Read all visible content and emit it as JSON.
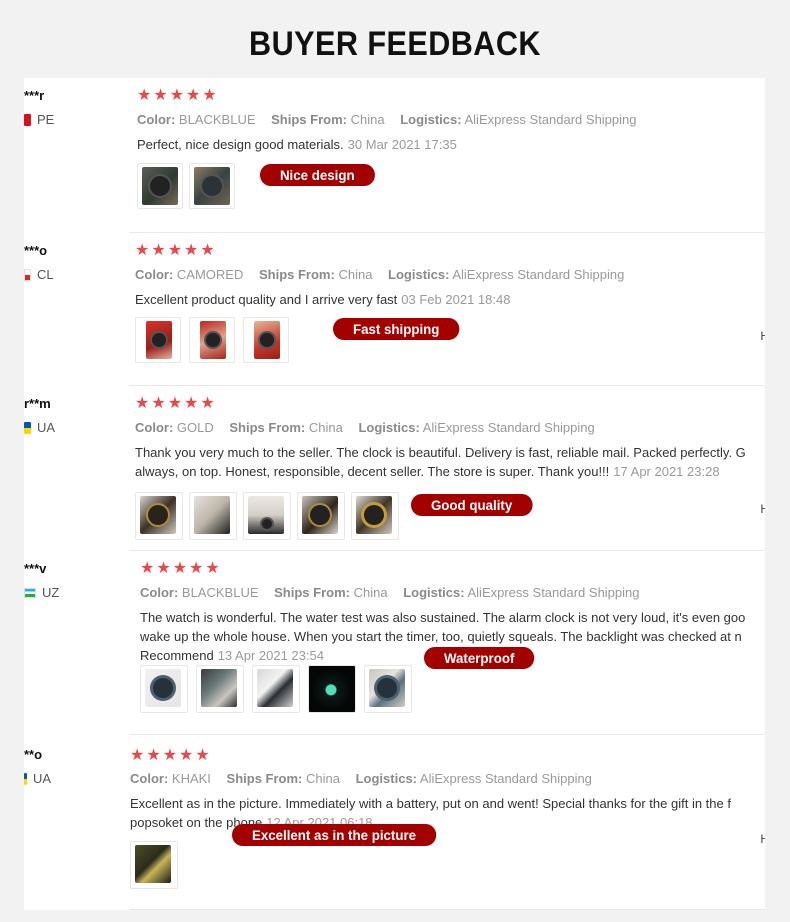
{
  "page": {
    "title": "BUYER FEEDBACK"
  },
  "colors": {
    "star": "#e8484a",
    "tag": "#a30000",
    "text": "#333333",
    "muted": "#999999"
  },
  "labels": {
    "color": "Color:",
    "ships_from": "Ships From:",
    "logistics": "Logistics:"
  },
  "reviews": [
    {
      "user": "***r",
      "country": "PE",
      "stars": [
        "★",
        "★",
        "★",
        "★",
        "★"
      ],
      "color": "BLACKBLUE",
      "ships_from": "China",
      "logistics": "AliExpress Standard Shipping",
      "comment_lines": [
        "Perfect, nice design good materials."
      ],
      "date": "30 Mar 2021 17:35",
      "tag": "Nice design",
      "edge": "",
      "photos": [
        "watch-photo",
        "watch-photo"
      ]
    },
    {
      "user": "***o",
      "country": "CL",
      "stars": [
        "★",
        "★",
        "★",
        "★",
        "★"
      ],
      "color": "CAMORED",
      "ships_from": "China",
      "logistics": "AliExpress Standard Shipping",
      "comment_lines": [
        "Excellent product quality and I arrive very fast"
      ],
      "date": "03 Feb 2021 18:48",
      "tag": "Fast shipping",
      "edge": "H",
      "photos": [
        "watch-photo",
        "watch-photo",
        "watch-photo"
      ]
    },
    {
      "user": "r**m",
      "country": "UA",
      "stars": [
        "★",
        "★",
        "★",
        "★",
        "★"
      ],
      "color": "GOLD",
      "ships_from": "China",
      "logistics": "AliExpress Standard Shipping",
      "comment_lines": [
        "Thank you very much to the seller. The clock is beautiful. Delivery is fast, reliable mail. Packed perfectly. G",
        "always, on top. Honest, responsible, decent seller. The store is super. Thank you!!!"
      ],
      "date": "17 Apr 2021 23:28",
      "tag": "Good quality",
      "edge": "H",
      "photos": [
        "watch-photo",
        "watch-photo",
        "watch-photo",
        "watch-photo",
        "watch-photo"
      ]
    },
    {
      "user": "***v",
      "country": "UZ",
      "stars": [
        "★",
        "★",
        "★",
        "★",
        "★"
      ],
      "color": "BLACKBLUE",
      "ships_from": "China",
      "logistics": "AliExpress Standard Shipping",
      "comment_lines": [
        "The watch is wonderful. The water test was also sustained. The alarm clock is not very loud, it's even goo",
        "wake up the whole house. When you start the timer, too, quietly squeals. The backlight was checked at n",
        "Recommend"
      ],
      "date": "13 Apr 2021 23:54",
      "tag": "Waterproof",
      "edge": "",
      "photos": [
        "watch-photo",
        "watch-photo",
        "watch-photo",
        "watch-photo",
        "watch-photo"
      ]
    },
    {
      "user": "**o",
      "country": "UA",
      "stars": [
        "★",
        "★",
        "★",
        "★",
        "★"
      ],
      "color": "KHAKI",
      "ships_from": "China",
      "logistics": "AliExpress Standard Shipping",
      "comment_lines": [
        "Excellent as in the picture. Immediately with a battery, put on and went! Special thanks for the gift in the f",
        "popsoket on the phone"
      ],
      "date": "12 Apr 2021 06:18",
      "tag": "Excellent as in the picture",
      "edge": "H",
      "photos": [
        "watch-photo"
      ]
    }
  ]
}
